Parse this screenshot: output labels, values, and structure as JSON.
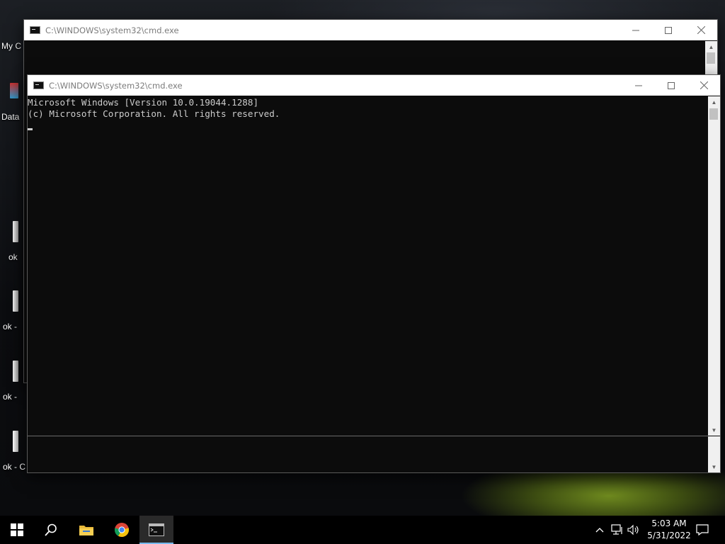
{
  "desktop": {
    "icons": [
      {
        "label": "My C",
        "name": "desktop-icon-my-computer"
      },
      {
        "label": "Data",
        "name": "desktop-icon-data"
      },
      {
        "label": "ok",
        "name": "desktop-icon-ok-1"
      },
      {
        "label": "ok -",
        "name": "desktop-icon-ok-2"
      },
      {
        "label": "ok -",
        "name": "desktop-icon-ok-3"
      },
      {
        "label": "ok - C",
        "name": "desktop-icon-ok-4"
      }
    ]
  },
  "back_window": {
    "title": "C:\\WINDOWS\\system32\\cmd.exe"
  },
  "front_window": {
    "title": "C:\\WINDOWS\\system32\\cmd.exe",
    "console_lines": [
      "Microsoft Windows [Version 10.0.19044.1288]",
      "(c) Microsoft Corporation. All rights reserved."
    ]
  },
  "taskbar": {
    "start_icon": "windows-logo-icon",
    "search_icon": "search-icon",
    "pinned": [
      {
        "name": "file-explorer-icon"
      },
      {
        "name": "chrome-icon"
      },
      {
        "name": "command-prompt-icon",
        "active": true
      }
    ],
    "tray": {
      "time": "5:03 AM",
      "date": "5/31/2022",
      "icons": [
        "chevron-up-icon",
        "network-icon",
        "volume-icon",
        "notification-icon"
      ]
    }
  },
  "colors": {
    "console_bg": "#0c0c0c",
    "console_text": "#cccccc",
    "taskbar_bg": "#000000",
    "active_indicator": "#76b9ed"
  }
}
